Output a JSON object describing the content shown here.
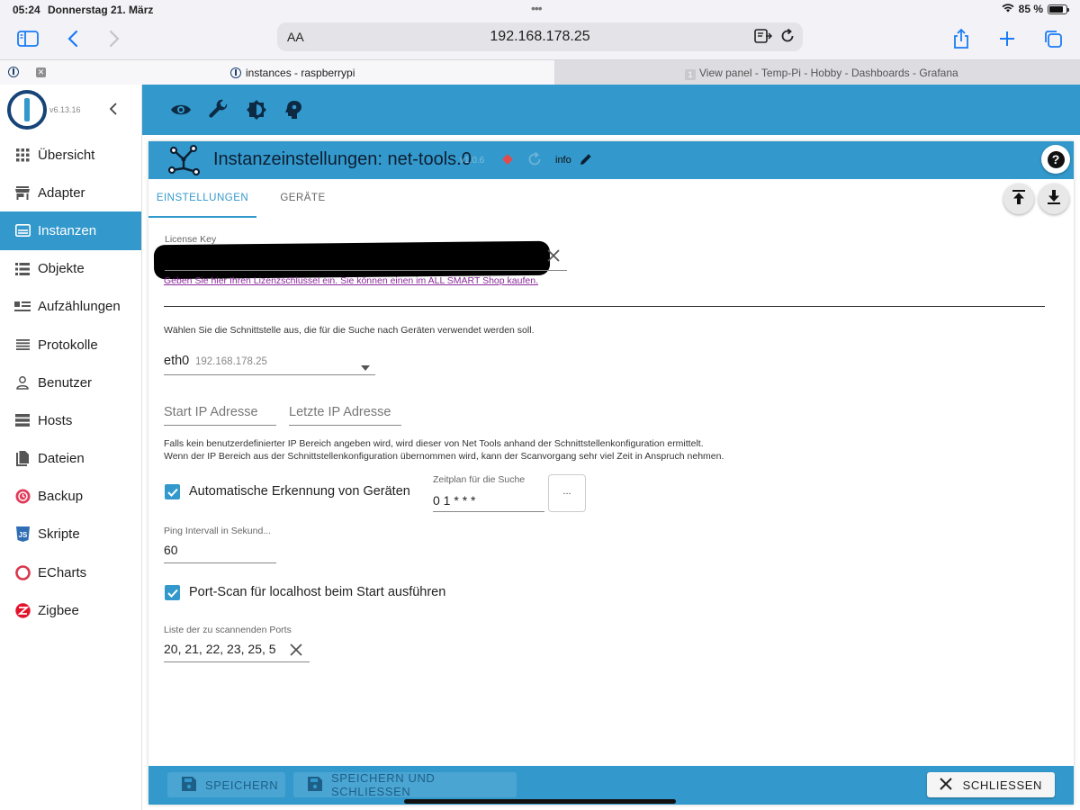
{
  "status_bar": {
    "time": "05:24",
    "date": "Donnerstag 21. März",
    "battery": "85 %",
    "battery_level": 0.85
  },
  "browser": {
    "text_size_label": "AA",
    "url": "192.168.178.25",
    "tabs": [
      {
        "title": "instances - raspberrypi",
        "active": true
      },
      {
        "title": "View panel - Temp-Pi - Hobby - Dashboards - Grafana",
        "badge": "1",
        "active": false
      }
    ]
  },
  "sidebar": {
    "version": "v6.13.16",
    "items": [
      {
        "label": "Übersicht",
        "icon": "grid-icon"
      },
      {
        "label": "Adapter",
        "icon": "store-icon"
      },
      {
        "label": "Instanzen",
        "icon": "instances-icon",
        "active": true
      },
      {
        "label": "Objekte",
        "icon": "list-icon"
      },
      {
        "label": "Aufzählungen",
        "icon": "enum-icon"
      },
      {
        "label": "Protokolle",
        "icon": "menu-icon"
      },
      {
        "label": "Benutzer",
        "icon": "user-icon"
      },
      {
        "label": "Hosts",
        "icon": "server-icon"
      },
      {
        "label": "Dateien",
        "icon": "files-icon"
      },
      {
        "label": "Backup",
        "icon": "backup-icon"
      },
      {
        "label": "Skripte",
        "icon": "js-icon"
      },
      {
        "label": "ECharts",
        "icon": "echarts-icon"
      },
      {
        "label": "Zigbee",
        "icon": "zigbee-icon"
      }
    ]
  },
  "panel": {
    "title": "Instanzeinstellungen: net-tools.0",
    "version": "v1.0.6",
    "info": "info",
    "tabs": [
      "EINSTELLUNGEN",
      "GERÄTE"
    ],
    "license": {
      "label": "License Key",
      "hint": "Geben Sie hier Ihren Lizenzschlüssel ein. Sie können einen im ALL SMART Shop kaufen."
    },
    "interface": {
      "description": "Wählen Sie die Schnittstelle aus, die für die Suche nach Geräten verwendet werden soll.",
      "value": "eth0",
      "secondary": "192.168.178.25"
    },
    "ip_range": {
      "start_placeholder": "Start IP Adresse",
      "end_placeholder": "Letzte IP Adresse",
      "note_line1": "Falls kein benutzerdefinierter IP Bereich angeben wird, wird dieser von Net Tools anhand der Schnittstellenkonfiguration ermittelt.",
      "note_line2": "Wenn der IP Bereich aus der Schnittstellenkonfiguration übernommen wird, kann der Scanvorgang sehr viel Zeit in Anspruch nehmen."
    },
    "auto_detect": {
      "label": "Automatische Erkennung von Geräten",
      "checked": true
    },
    "schedule": {
      "label": "Zeitplan für die Suche",
      "value": "0 1 * * *",
      "button": "..."
    },
    "ping": {
      "label": "Ping Intervall in Sekund...",
      "value": "60"
    },
    "port_scan": {
      "label": "Port-Scan für localhost beim Start ausführen",
      "checked": true
    },
    "ports": {
      "label": "Liste der zu scannenden Ports",
      "value": "20, 21, 22, 23, 25, 5"
    }
  },
  "footer": {
    "save": "SPEICHERN",
    "save_close": "SPEICHERN UND SCHLIESSEN",
    "close": "SCHLIESSEN"
  },
  "colors": {
    "accent": "#3399cc",
    "link": "#8a2a9a",
    "ios_blue": "#1a7cf5"
  }
}
